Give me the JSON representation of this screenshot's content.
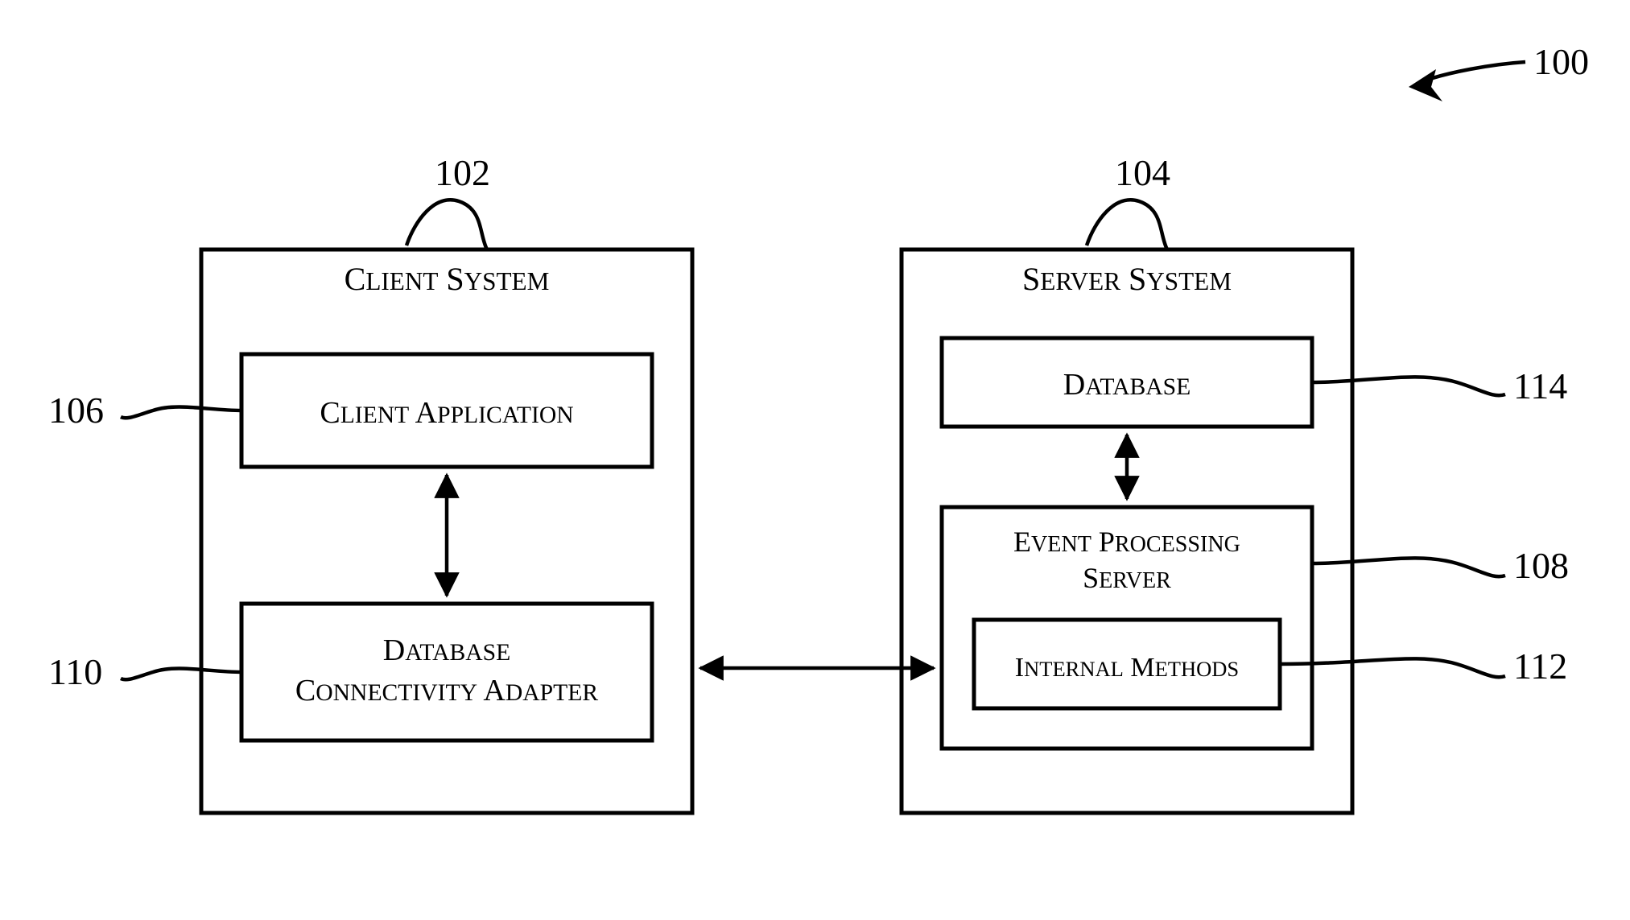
{
  "figure_ref": "100",
  "client": {
    "ref": "102",
    "title": "Client System",
    "app": {
      "ref": "106",
      "label": "Client Application"
    },
    "adapter": {
      "ref": "110",
      "label_line1": "Database",
      "label_line2": "Connectivity Adapter"
    }
  },
  "server": {
    "ref": "104",
    "title": "Server System",
    "db": {
      "ref": "114",
      "label": "Database"
    },
    "eps": {
      "ref": "108",
      "label_line1": "Event Processing",
      "label_line2": "Server"
    },
    "im": {
      "ref": "112",
      "label": "Internal Methods"
    }
  }
}
